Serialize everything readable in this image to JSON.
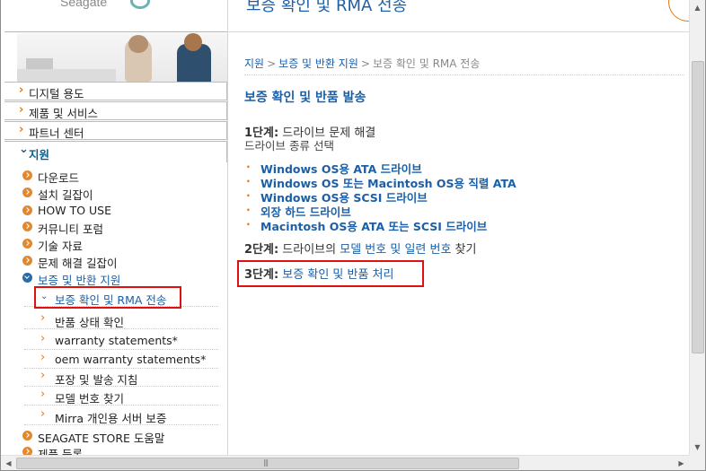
{
  "header": {
    "logo_text": "Seagate",
    "title": "보증 확인 및 RMA 전송"
  },
  "sidebar": {
    "tabs": [
      {
        "label": "디지털 용도",
        "chev": "›"
      },
      {
        "label": "제품 및 서비스",
        "chev": "›"
      },
      {
        "label": "파트너 센터",
        "chev": "›"
      },
      {
        "label": "지원",
        "chev": "⌄"
      }
    ],
    "support_items": [
      {
        "label": "다운로드"
      },
      {
        "label": "설치 길잡이"
      },
      {
        "label": "HOW TO USE"
      },
      {
        "label": "커뮤니티 포럼"
      },
      {
        "label": "기술 자료"
      },
      {
        "label": "문제 해결 길잡이"
      },
      {
        "label": "보증 및 반환 지원"
      }
    ],
    "warranty_sub_items": [
      {
        "label": "보증 확인 및 RMA 전송",
        "chev": "⌄"
      },
      {
        "label": "반품 상태 확인",
        "chev": "›"
      },
      {
        "label": "warranty statements*",
        "chev": "›"
      },
      {
        "label": "oem warranty statements*",
        "chev": "›"
      },
      {
        "label": "포장 및 발송 지침",
        "chev": "›"
      },
      {
        "label": "모델 번호 찾기",
        "chev": "›"
      },
      {
        "label": "Mirra 개인용 서버 보증",
        "chev": "›"
      }
    ],
    "more_items": [
      {
        "label": "SEAGATE STORE 도움말"
      },
      {
        "label": "제품 등록"
      }
    ]
  },
  "breadcrumb": {
    "items": [
      "지원",
      "보증 및 반환 지원"
    ],
    "current": "보증 확인 및 RMA 전송",
    "separator": ">"
  },
  "main": {
    "section_title": "보증 확인 및 반품 발송",
    "step1": {
      "prefix": "1단계:",
      "text": " 드라이브 문제 해결",
      "sub": "드라이브 종류 선택"
    },
    "drives": [
      "Windows OS용 ATA 드라이브",
      "Windows OS 또는 Macintosh OS용 직렬 ATA",
      "Windows OS용 SCSI 드라이브",
      "외장 하드 드라이브",
      "Macintosh OS용 ATA 또는 SCSI 드라이브"
    ],
    "step2": {
      "prefix": "2단계:",
      "pre": " 드라이브의 ",
      "link": "모델 번호 및 일련 번호",
      "post": " 찾기"
    },
    "step3": {
      "prefix": "3단계:",
      "link": " 보증 확인 및 반품 처리"
    }
  },
  "colors": {
    "link": "#1c5fa6",
    "accent_orange": "#e07a1f",
    "highlight_red": "#e01010"
  },
  "scrollbar": {
    "up": "▲",
    "down": "▼",
    "left": "◀",
    "right": "▶",
    "grip": "|||"
  }
}
